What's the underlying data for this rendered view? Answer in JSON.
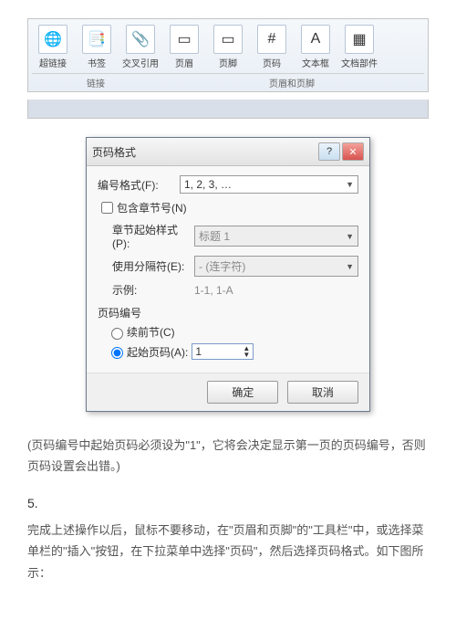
{
  "ribbon": {
    "items": [
      {
        "label": "超链接",
        "icon": "🌐"
      },
      {
        "label": "书签",
        "icon": "📑"
      },
      {
        "label": "交叉引用",
        "icon": "📎"
      },
      {
        "label": "页眉",
        "icon": "▭"
      },
      {
        "label": "页脚",
        "icon": "▭"
      },
      {
        "label": "页码",
        "icon": "#"
      },
      {
        "label": "文本框",
        "icon": "A"
      },
      {
        "label": "文档部件",
        "icon": "▦"
      }
    ],
    "groups": [
      "链接",
      "页眉和页脚"
    ]
  },
  "dialog": {
    "title": "页码格式",
    "format_label": "编号格式(F):",
    "format_value": "1, 2, 3, …",
    "include_chapter": "包含章节号(N)",
    "chapter_style_label": "章节起始样式(P):",
    "chapter_style_value": "标题 1",
    "separator_label": "使用分隔符(E):",
    "separator_value": "- (连字符)",
    "example_label": "示例:",
    "example_value": "1-1, 1-A",
    "numbering_title": "页码编号",
    "continue_label": "续前节(C)",
    "start_label": "起始页码(A):",
    "start_value": "1",
    "ok": "确定",
    "cancel": "取消"
  },
  "note1": "(页码编号中起始页码必须设为\"1\"，它将会决定显示第一页的页码编号，否则页码设置会出错。)",
  "step": "5.",
  "note2": "完成上述操作以后，鼠标不要移动，在\"页眉和页脚\"的\"工具栏\"中，或选择菜单栏的\"插入\"按钮，在下拉菜单中选择\"页码\"，然后选择页码格式。如下图所示："
}
